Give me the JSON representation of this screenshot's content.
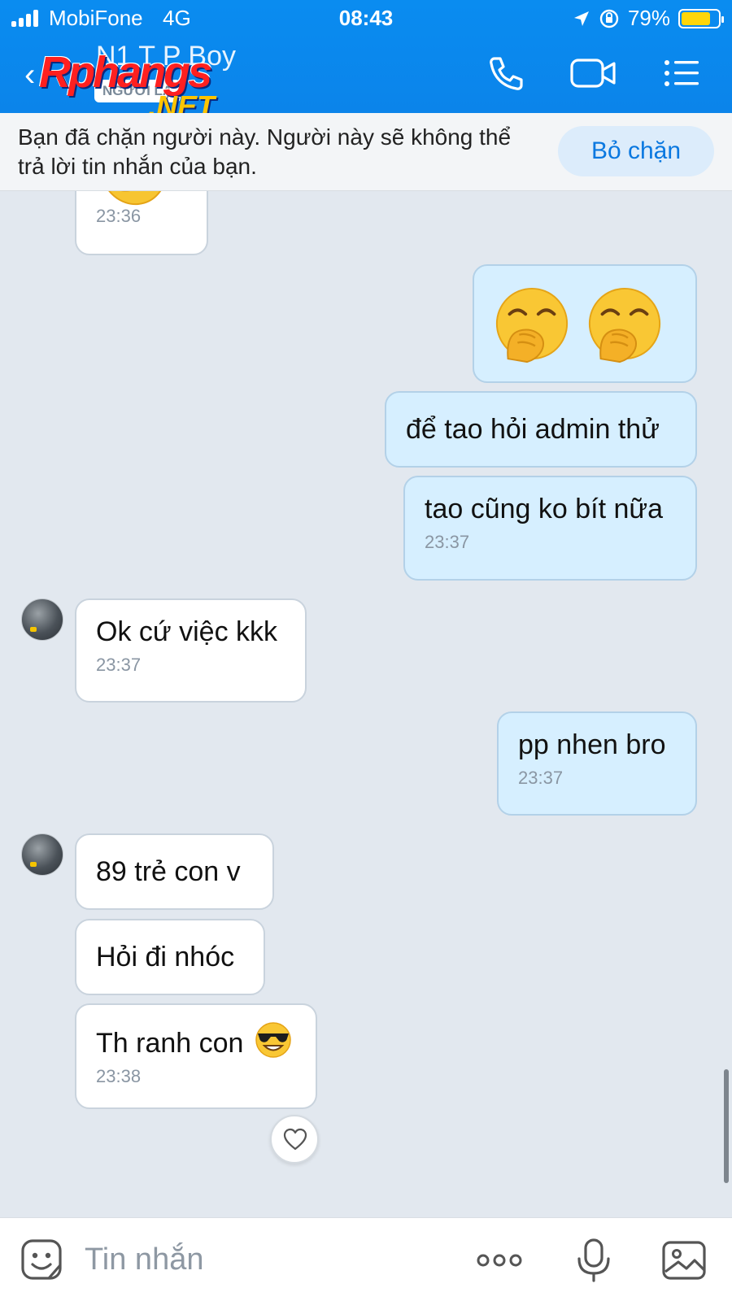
{
  "status_bar": {
    "carrier": "MobiFone",
    "network": "4G",
    "time": "08:43",
    "battery_text": "79%",
    "battery_level": 0.79
  },
  "header": {
    "contact_name": "N1 T P Boy",
    "stranger_label": "NGƯỜI LẠ",
    "watermark_main": "Rphangs",
    "watermark_sub": ".NET",
    "icons": [
      "back-arrow-icon",
      "phone-icon",
      "video-call-icon",
      "menu-list-icon"
    ]
  },
  "blocked_banner": {
    "text": "Bạn đã chặn người này. Người này sẽ không thể trả lời tin nhắn của bạn.",
    "unblock_label": "Bỏ chặn"
  },
  "messages": [
    {
      "side": "in",
      "text": "",
      "time": "23:36",
      "partial_emoji": true
    },
    {
      "side": "out",
      "emoji": [
        "face-with-hand-over-mouth",
        "face-with-hand-over-mouth"
      ]
    },
    {
      "side": "out",
      "text": "để tao hỏi admin thử"
    },
    {
      "side": "out",
      "text": "tao cũng ko bít nữa",
      "time": "23:37"
    },
    {
      "side": "in",
      "text": "Ok cứ việc kkk",
      "time": "23:37"
    },
    {
      "side": "out",
      "text": "pp nhen bro",
      "time": "23:37"
    },
    {
      "side": "in",
      "text": "89 trẻ con v"
    },
    {
      "side": "in",
      "text": "Hỏi đi nhóc"
    },
    {
      "side": "in",
      "text": "Th ranh con",
      "emoji_suffix": "smiling-face-with-sunglasses",
      "time": "23:38"
    }
  ],
  "composer": {
    "placeholder": "Tin nhắn",
    "icons": [
      "sticker-icon",
      "more-options-icon",
      "microphone-icon",
      "image-icon"
    ]
  },
  "colors": {
    "header_blue": "#0a8cf0",
    "outgoing_bubble": "#d6efff",
    "incoming_bubble": "#ffffff",
    "chat_background": "#e2e8ef",
    "unblock_text": "#0a78e0"
  }
}
